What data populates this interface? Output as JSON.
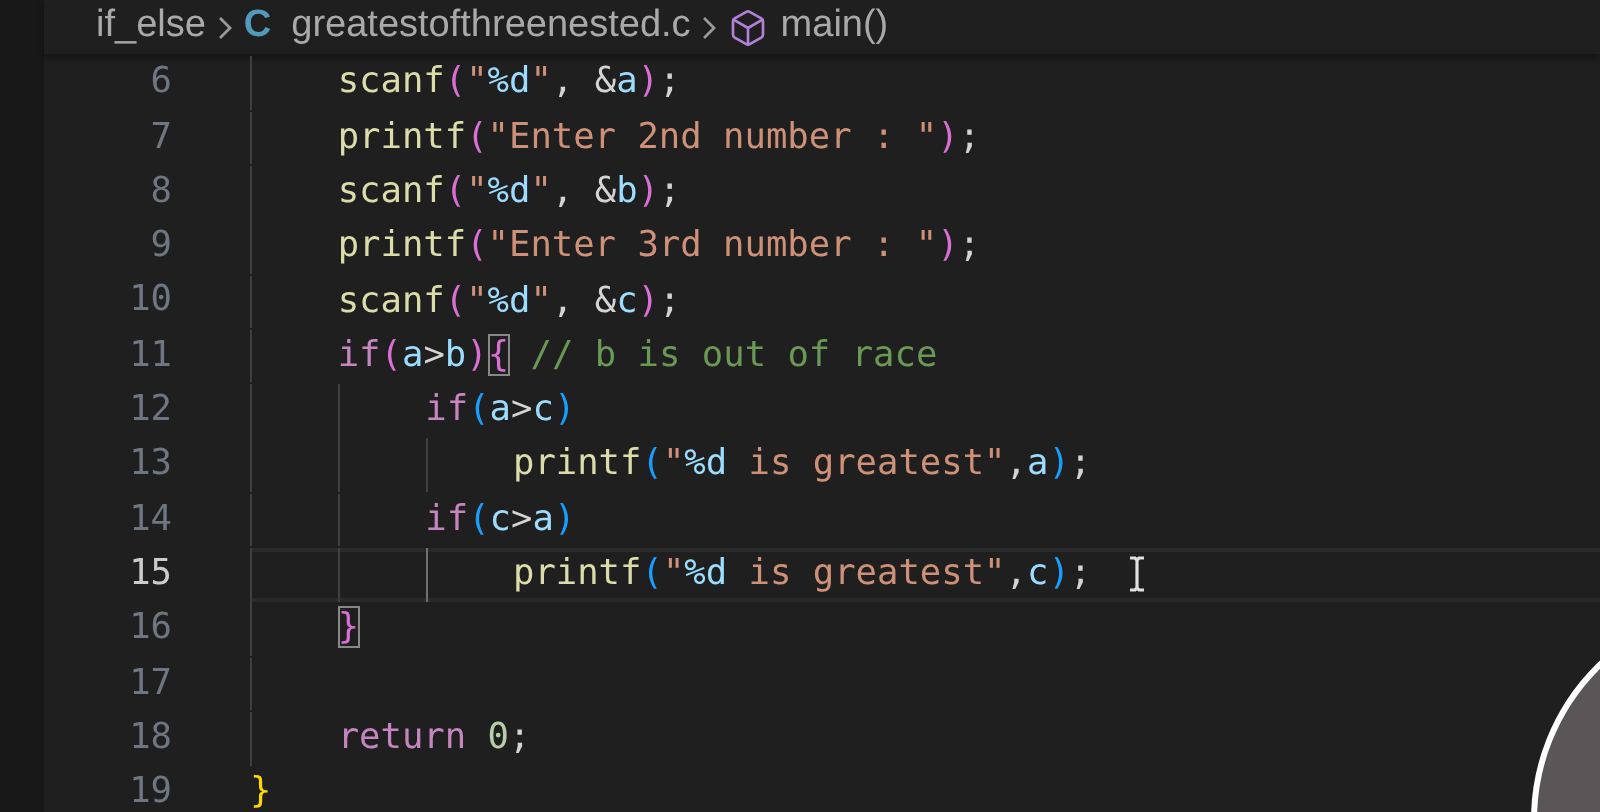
{
  "breadcrumb": [
    {
      "kind": "folder",
      "text": "if_else"
    },
    {
      "kind": "file",
      "badge": "C",
      "text": "greatestofthreenested.c"
    },
    {
      "kind": "symbol",
      "text": "main()"
    }
  ],
  "lines": [
    {
      "number": "6",
      "current": false,
      "tokens": [
        {
          "kind": "function",
          "text": "    scanf"
        },
        {
          "kind": "bracket1",
          "text": "("
        },
        {
          "kind": "string",
          "text": "\""
        },
        {
          "kind": "format",
          "text": "%d"
        },
        {
          "kind": "string",
          "text": "\""
        },
        {
          "kind": "plain",
          "text": ", &"
        },
        {
          "kind": "variable",
          "text": "a"
        },
        {
          "kind": "bracket1",
          "text": ")"
        },
        {
          "kind": "plain",
          "text": ";"
        }
      ]
    },
    {
      "number": "7",
      "current": false,
      "tokens": [
        {
          "kind": "function",
          "text": "    printf"
        },
        {
          "kind": "bracket1",
          "text": "("
        },
        {
          "kind": "string",
          "text": "\"Enter 2nd number : \""
        },
        {
          "kind": "bracket1",
          "text": ")"
        },
        {
          "kind": "plain",
          "text": ";"
        }
      ]
    },
    {
      "number": "8",
      "current": false,
      "tokens": [
        {
          "kind": "function",
          "text": "    scanf"
        },
        {
          "kind": "bracket1",
          "text": "("
        },
        {
          "kind": "string",
          "text": "\""
        },
        {
          "kind": "format",
          "text": "%d"
        },
        {
          "kind": "string",
          "text": "\""
        },
        {
          "kind": "plain",
          "text": ", &"
        },
        {
          "kind": "variable",
          "text": "b"
        },
        {
          "kind": "bracket1",
          "text": ")"
        },
        {
          "kind": "plain",
          "text": ";"
        }
      ]
    },
    {
      "number": "9",
      "current": false,
      "tokens": [
        {
          "kind": "function",
          "text": "    printf"
        },
        {
          "kind": "bracket1",
          "text": "("
        },
        {
          "kind": "string",
          "text": "\"Enter 3rd number : \""
        },
        {
          "kind": "bracket1",
          "text": ")"
        },
        {
          "kind": "plain",
          "text": ";"
        }
      ]
    },
    {
      "number": "10",
      "current": false,
      "tokens": [
        {
          "kind": "function",
          "text": "    scanf"
        },
        {
          "kind": "bracket1",
          "text": "("
        },
        {
          "kind": "string",
          "text": "\""
        },
        {
          "kind": "format",
          "text": "%d"
        },
        {
          "kind": "string",
          "text": "\""
        },
        {
          "kind": "plain",
          "text": ", &"
        },
        {
          "kind": "variable",
          "text": "c"
        },
        {
          "kind": "bracket1",
          "text": ")"
        },
        {
          "kind": "plain",
          "text": ";"
        }
      ]
    },
    {
      "number": "11",
      "current": false,
      "tokens": [
        {
          "kind": "keyword",
          "text": "    if"
        },
        {
          "kind": "bracket1",
          "text": "("
        },
        {
          "kind": "variable",
          "text": "a"
        },
        {
          "kind": "plain",
          "text": ">"
        },
        {
          "kind": "variable",
          "text": "b"
        },
        {
          "kind": "bracket1",
          "text": ")"
        },
        {
          "kind": "bracket1",
          "text": "{",
          "matched": true
        },
        {
          "kind": "comment",
          "text": " // b is out of race"
        }
      ]
    },
    {
      "number": "12",
      "current": false,
      "tokens": [
        {
          "kind": "keyword",
          "text": "        if"
        },
        {
          "kind": "bracket2",
          "text": "("
        },
        {
          "kind": "variable",
          "text": "a"
        },
        {
          "kind": "plain",
          "text": ">"
        },
        {
          "kind": "variable",
          "text": "c"
        },
        {
          "kind": "bracket2",
          "text": ")"
        }
      ]
    },
    {
      "number": "13",
      "current": false,
      "tokens": [
        {
          "kind": "function",
          "text": "            printf"
        },
        {
          "kind": "bracket2",
          "text": "("
        },
        {
          "kind": "string",
          "text": "\""
        },
        {
          "kind": "format",
          "text": "%d"
        },
        {
          "kind": "string",
          "text": " is greatest\""
        },
        {
          "kind": "plain",
          "text": ","
        },
        {
          "kind": "variable",
          "text": "a"
        },
        {
          "kind": "bracket2",
          "text": ")"
        },
        {
          "kind": "plain",
          "text": ";"
        }
      ]
    },
    {
      "number": "14",
      "current": false,
      "tokens": [
        {
          "kind": "keyword",
          "text": "        if"
        },
        {
          "kind": "bracket2",
          "text": "("
        },
        {
          "kind": "variable",
          "text": "c"
        },
        {
          "kind": "plain",
          "text": ">"
        },
        {
          "kind": "variable",
          "text": "a"
        },
        {
          "kind": "bracket2",
          "text": ")"
        }
      ]
    },
    {
      "number": "15",
      "current": true,
      "tokens": [
        {
          "kind": "function",
          "text": "            printf"
        },
        {
          "kind": "bracket2",
          "text": "("
        },
        {
          "kind": "string",
          "text": "\""
        },
        {
          "kind": "format",
          "text": "%d"
        },
        {
          "kind": "string",
          "text": " is greatest\""
        },
        {
          "kind": "plain",
          "text": ","
        },
        {
          "kind": "variable",
          "text": "c"
        },
        {
          "kind": "bracket2",
          "text": ")"
        },
        {
          "kind": "plain",
          "text": ";"
        }
      ]
    },
    {
      "number": "16",
      "current": false,
      "tokens": [
        {
          "kind": "bracket1",
          "text": "    }",
          "matched": true
        }
      ]
    },
    {
      "number": "17",
      "current": false
    },
    {
      "number": "18",
      "current": false,
      "tokens": [
        {
          "kind": "keyword",
          "text": "    return "
        },
        {
          "kind": "number",
          "text": "0"
        },
        {
          "kind": "plain",
          "text": ";"
        }
      ]
    },
    {
      "number": "19",
      "current": false,
      "tokens": [
        {
          "kind": "bracket3",
          "text": "}"
        }
      ]
    }
  ]
}
